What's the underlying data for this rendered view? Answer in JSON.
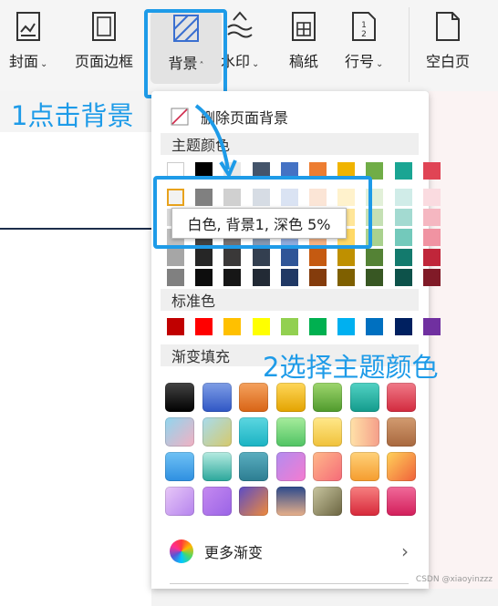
{
  "ribbon": {
    "cover": "封面",
    "page_border": "页面边框",
    "background": "背景",
    "watermark": "水印",
    "manuscript": "稿纸",
    "line_number": "行号",
    "blank_page": "空白页",
    "caret_down": "⌄",
    "caret_up": "˄"
  },
  "annotations": {
    "step1": "1点击背景",
    "step2": "2选择主题颜色"
  },
  "panel": {
    "remove_background": "删除页面背景",
    "theme_colors_heading": "主题颜色",
    "standard_colors_heading": "标准色",
    "gradient_heading": "渐变填充",
    "more_gradients": "更多渐变",
    "tooltip": "白色, 背景1, 深色 5%"
  },
  "colors": {
    "accent": "#1e9be8",
    "theme_top": [
      "#ffffff",
      "#000000",
      "#e8e8e8",
      "#44546a",
      "#4472c4",
      "#ed7d31",
      "#f0b400",
      "#70ad47",
      "#1aa593",
      "#e04455"
    ],
    "theme_shades": [
      [
        "#f2f2f2",
        "#808080",
        "#d0d0d0",
        "#d6dce4",
        "#dae3f3",
        "#fbe5d6",
        "#fff2cc",
        "#e2f0d9",
        "#d0ece8",
        "#fadbe0"
      ],
      [
        "#d9d9d9",
        "#595959",
        "#aeaaaa",
        "#adb9ca",
        "#b4c7e7",
        "#f8cbad",
        "#ffe699",
        "#c5e0b4",
        "#a3dad1",
        "#f5b7c1"
      ],
      [
        "#bfbfbf",
        "#404040",
        "#757171",
        "#8497b0",
        "#8faadc",
        "#f4b183",
        "#ffd966",
        "#a9d18e",
        "#73c9bb",
        "#f093a2"
      ],
      [
        "#a6a6a6",
        "#262626",
        "#3a3838",
        "#333f50",
        "#2f5597",
        "#c55a11",
        "#bf9000",
        "#548235",
        "#137a6d",
        "#c0263a"
      ],
      [
        "#808080",
        "#0d0d0d",
        "#161616",
        "#222a35",
        "#203864",
        "#843c0c",
        "#7f6000",
        "#385723",
        "#0d524a",
        "#801a27"
      ]
    ],
    "standard": [
      "#c00000",
      "#ff0000",
      "#ffc000",
      "#ffff00",
      "#92d050",
      "#00b050",
      "#00b0f0",
      "#0070c0",
      "#002060",
      "#7030a0"
    ],
    "gradients": [
      [
        "linear-gradient(#444,#000)",
        "linear-gradient(#7f9ee6,#2f56c4)",
        "linear-gradient(#f5a25e,#d86415)",
        "linear-gradient(#ffd75a,#e3a300)",
        "linear-gradient(#9ed66e,#4f9a2c)",
        "linear-gradient(#52d2c4,#139b8c)",
        "linear-gradient(#f07a88,#d22a3e)"
      ],
      [
        "linear-gradient(135deg,#8fd6ef,#f3b0c2)",
        "linear-gradient(135deg,#a7dcef,#d6c96a)",
        "linear-gradient(#5cd6e0,#1ab3c3)",
        "linear-gradient(#a7ec9c,#4fc363)",
        "linear-gradient(#ffe88a,#f0c13a)",
        "linear-gradient(90deg,#ffe2a8,#f59f8a)",
        "linear-gradient(#d29b70,#a8683e)"
      ],
      [
        "linear-gradient(#6fc2f5,#2e8fe0)",
        "linear-gradient(#b7ece2,#2aa69a)",
        "linear-gradient(#5aaec0,#2c7d91)",
        "linear-gradient(135deg,#b28cf0,#f57bd0)",
        "linear-gradient(135deg,#ffb98a,#f56a78)",
        "linear-gradient(#ffd27a,#f59c2e)",
        "linear-gradient(135deg,#ffd35a,#f0603a)"
      ],
      [
        "linear-gradient(135deg,#e8c8f7,#b583ee)",
        "linear-gradient(135deg,#c58af0,#9a63e6)",
        "linear-gradient(135deg,#5a4cc7,#f08a3a)",
        "linear-gradient(#2c4a8c,#e8b08a)",
        "linear-gradient(135deg,#c9c6a0,#6a6440)",
        "linear-gradient(#f78080,#d7283a)",
        "linear-gradient(#f06a9a,#d21e5a)"
      ]
    ]
  },
  "footer": {
    "watermark_text": "CSDN @xiaoyinzzz"
  }
}
